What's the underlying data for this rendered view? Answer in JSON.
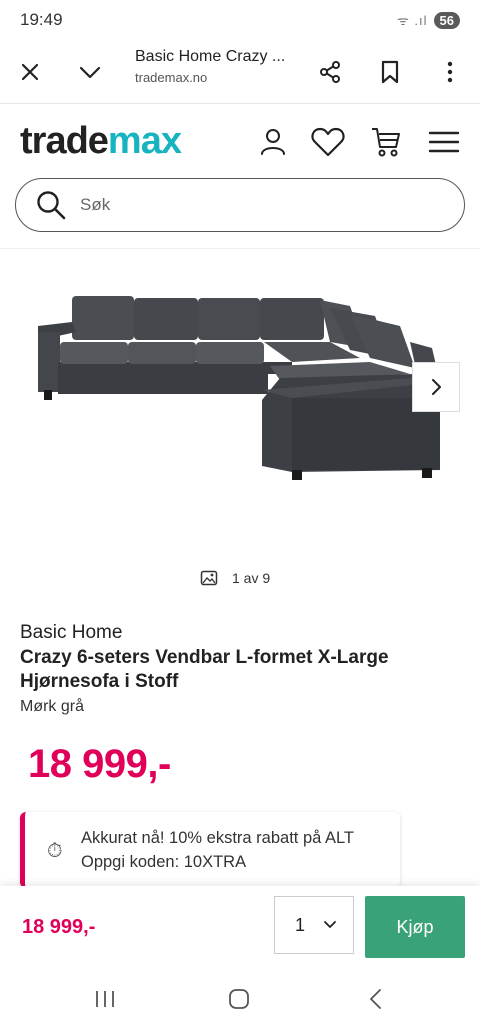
{
  "status_bar": {
    "time": "19:49",
    "signal": "ᯤ .ıl",
    "battery": "56"
  },
  "browser": {
    "title": "Basic Home Crazy ...",
    "url": "trademax.no"
  },
  "site": {
    "logo_part1": "trade",
    "logo_part2": "max",
    "brand_color": "#16b3c0"
  },
  "search": {
    "placeholder": "Søk"
  },
  "gallery": {
    "counter": "1 av 9"
  },
  "product": {
    "brand": "Basic Home",
    "title": "Crazy 6-seters Vendbar L-formet X-Large Hjørnesofa i Stoff",
    "variant": "Mørk grå",
    "price": "18 999,-",
    "price_color": "#e0005a"
  },
  "promo": {
    "icon": "stopwatch-icon",
    "line1": "Akkurat nå! 10% ekstra rabatt på ALT",
    "line2": "Oppgi koden: 10XTRA"
  },
  "buy_bar": {
    "price": "18 999,-",
    "quantity": "1",
    "buy_label": "Kjøp",
    "buy_color": "#3aa278"
  }
}
